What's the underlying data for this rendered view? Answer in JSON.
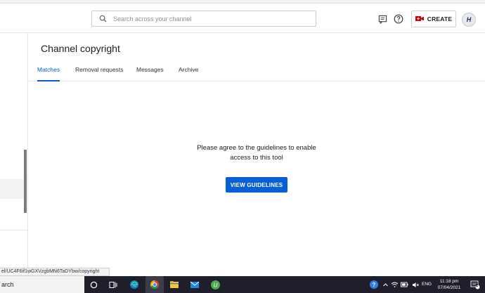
{
  "header": {
    "search_placeholder": "Search across your channel",
    "create_label": "CREATE",
    "avatar_letter": "H"
  },
  "page": {
    "title": "Channel copyright",
    "tabs": [
      {
        "label": "Matches",
        "active": true
      },
      {
        "label": "Removal requests",
        "active": false
      },
      {
        "label": "Messages",
        "active": false
      },
      {
        "label": "Archive",
        "active": false
      }
    ],
    "message": "Please agree to the guidelines to enable access to this tool",
    "button_label": "VIEW GUIDELINES"
  },
  "status_url": "el/UC4F6if1wGXVzgbMN6TaDYbw/copyright",
  "taskbar": {
    "search_text": "arch",
    "tray": {
      "language": "ENG",
      "time": "11:18 pm",
      "date": "07/04/2021",
      "notification_count": "2"
    }
  },
  "colors": {
    "accent": "#065fd4",
    "create_icon": "#cc0000",
    "taskbar": "#1f1f2b"
  }
}
